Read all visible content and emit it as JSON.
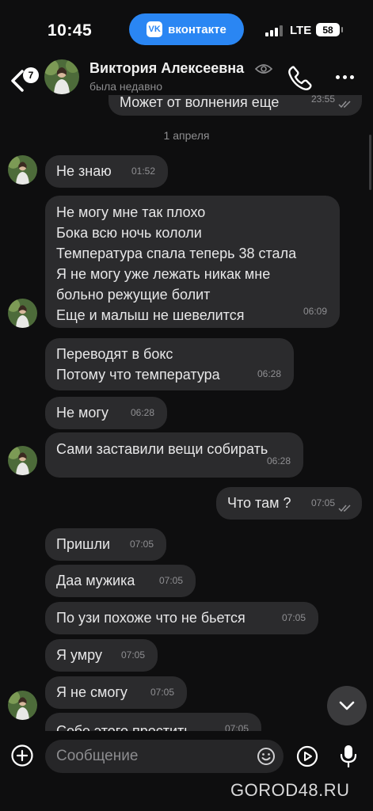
{
  "status_bar": {
    "time": "10:45",
    "pill": "вконтакте",
    "pill_logo": "vk",
    "network": "LTE",
    "battery": "58"
  },
  "header": {
    "back_badge": "7",
    "contact_name": "Виктория Алексеевна",
    "contact_status": "была недавно",
    "icons": [
      "back-arrow-icon",
      "eye-icon",
      "phone-icon",
      "more-icon"
    ]
  },
  "chat": {
    "partial_top": {
      "text": "Может от волнения еще",
      "time": "23:55"
    },
    "date_divider": "1 апреля",
    "messages": [
      {
        "lines": [
          "Не знаю"
        ],
        "time": "01:52"
      },
      {
        "lines": [
          "Не могу мне так плохо",
          "Бока всю ночь кололи",
          "Температура спала теперь 38 стала",
          "Я не могу уже лежать никак мне",
          "больно режущие болит",
          "Еще и малыш не шевелится"
        ],
        "time": "06:09"
      },
      {
        "lines": [
          "Переводят в бокс",
          "Потому что температура"
        ],
        "time": "06:28"
      },
      {
        "lines": [
          "Не могу"
        ],
        "time": "06:28"
      },
      {
        "lines": [
          "Сами заставили вещи собирать"
        ],
        "time": "06:28"
      },
      {
        "lines": [
          "Что там ?"
        ],
        "time": "07:05",
        "outgoing": true
      },
      {
        "lines": [
          "Пришли"
        ],
        "time": "07:05"
      },
      {
        "lines": [
          "Даа мужика"
        ],
        "time": "07:05"
      },
      {
        "lines": [
          "По узи похоже что не бьется"
        ],
        "time": "07:05"
      },
      {
        "lines": [
          "Я умру"
        ],
        "time": "07:05"
      },
      {
        "lines": [
          "Я не смогу"
        ],
        "time": "07:05"
      },
      {
        "lines": [
          "Себе этого простить"
        ],
        "time": "07:05"
      }
    ]
  },
  "input": {
    "placeholder": "Сообщение"
  },
  "watermark": "GOROD48.RU",
  "colors": {
    "background": "#0e0e0f",
    "bubble": "#2b2b2d",
    "accent": "#2a86f3"
  }
}
